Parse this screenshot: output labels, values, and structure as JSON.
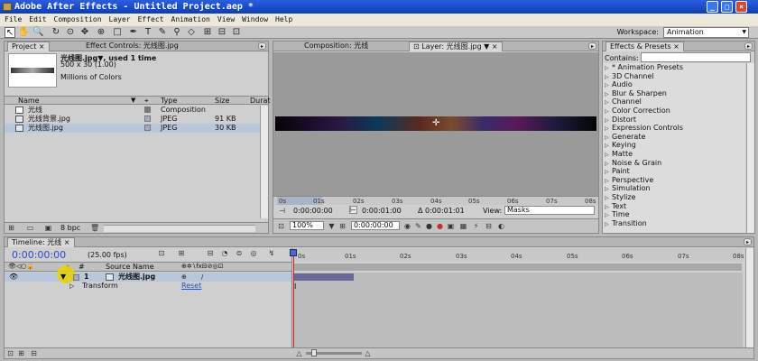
{
  "app": {
    "title": "Adobe After Effects - Untitled Project.aep *",
    "window_buttons": [
      "_",
      "□",
      "×"
    ]
  },
  "menu": [
    "File",
    "Edit",
    "Composition",
    "Layer",
    "Effect",
    "Animation",
    "View",
    "Window",
    "Help"
  ],
  "workspace": {
    "label": "Workspace:",
    "value": "Animation"
  },
  "project_panel": {
    "tabs": [
      "Project",
      "Effect Controls: 光线图.jpg"
    ],
    "preview": {
      "filename": "光线图.jpg▼, used 1 time",
      "size": "500 x 30 (1.00)",
      "colors": "Millions of Colors"
    },
    "columns": [
      "Name",
      "Type",
      "Size",
      "Durat"
    ],
    "items": [
      {
        "name": "光线",
        "type": "Composition",
        "size": "",
        "swatch": "#7a7a7a",
        "icon": "composition-icon"
      },
      {
        "name": "光线背景.jpg",
        "type": "JPEG",
        "size": "91 KB",
        "swatch": "#a8a8c8",
        "icon": "footage-icon"
      },
      {
        "name": "光线图.jpg",
        "type": "JPEG",
        "size": "30 KB",
        "swatch": "#a8a8c8",
        "icon": "footage-icon",
        "selected": true
      }
    ],
    "footer_bpc": "8 bpc"
  },
  "comp_panel": {
    "tabs": [
      "Composition: 光线",
      "Layer: 光线图.jpg"
    ],
    "ruler": [
      "0s",
      "01s",
      "02s",
      "03s",
      "04s",
      "05s",
      "06s",
      "07s",
      "08s"
    ],
    "time_in": "0:00:00:00",
    "time_out": "0:00:01:00",
    "duration": "Δ 0:00:01:01",
    "view_label": "View:",
    "view_value": "Masks",
    "zoom": "100%",
    "time_field": "0:00:00:00"
  },
  "effects_panel": {
    "tab": "Effects & Presets",
    "contains_label": "Contains:",
    "items": [
      "* Animation Presets",
      "3D Channel",
      "Audio",
      "Blur & Sharpen",
      "Channel",
      "Color Correction",
      "Distort",
      "Expression Controls",
      "Generate",
      "Keying",
      "Matte",
      "Noise & Grain",
      "Paint",
      "Perspective",
      "Simulation",
      "Stylize",
      "Text",
      "Time",
      "Transition"
    ]
  },
  "timeline": {
    "tab": "Timeline: 光线",
    "current_time": "0:00:00:00",
    "fps": "(25.00 fps)",
    "ruler": [
      "0s",
      "01s",
      "02s",
      "03s",
      "04s",
      "05s",
      "06s",
      "07s",
      "08s"
    ],
    "source_name_header": "Source Name",
    "layer": {
      "number": "1",
      "name": "光线图.jpg"
    },
    "property": {
      "name": "Transform",
      "value": "Reset"
    }
  },
  "colors": {
    "titlebar": "#0a3fb8",
    "current_time": "#2a4ad0",
    "playhead": "#e02020",
    "layer_bar": "#6a6a9a",
    "selection": "#b9c7dc"
  }
}
